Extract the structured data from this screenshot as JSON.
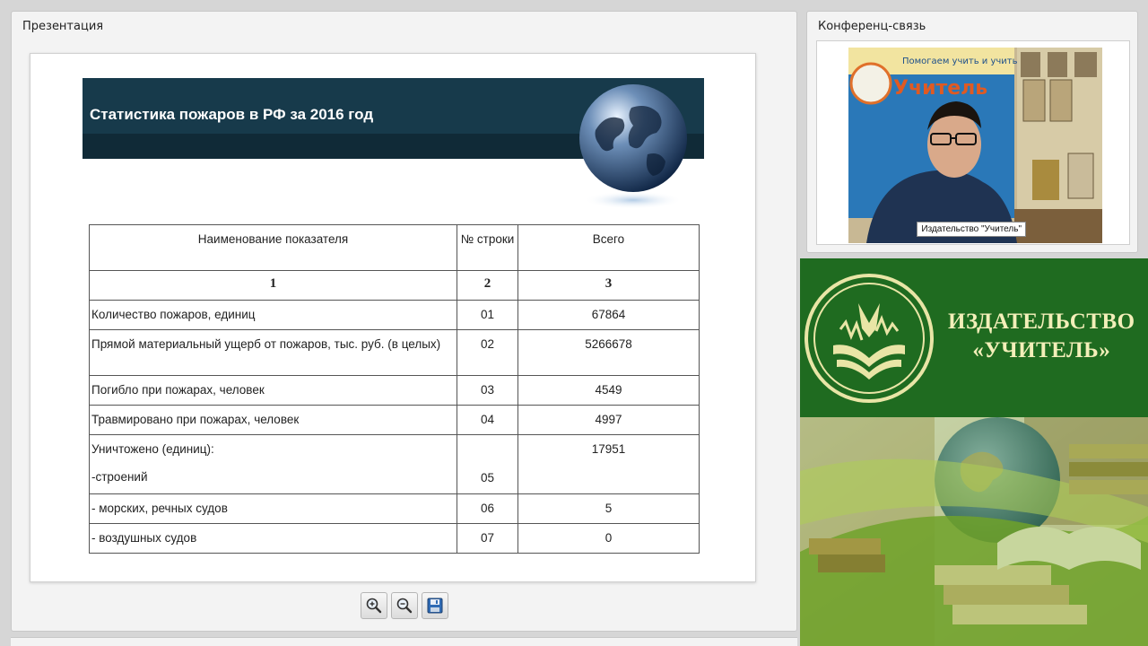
{
  "presentation_panel": {
    "title": "Презентация"
  },
  "slide": {
    "title": "Статистика пожаров в РФ за 2016 год",
    "table": {
      "headers": [
        "Наименование показателя",
        "№ строки",
        "Всего"
      ],
      "column_numbers": [
        "1",
        "2",
        "3"
      ],
      "rows": [
        {
          "name": "Количество пожаров, единиц",
          "line": "01",
          "total": "67864"
        },
        {
          "name": "Прямой материальный ущерб от пожаров, тыс. руб. (в целых)",
          "line": "02",
          "total": "5266678"
        },
        {
          "name": "Погибло при пожарах, человек",
          "line": "03",
          "total": "4549"
        },
        {
          "name": "Травмировано при пожарах, человек",
          "line": "04",
          "total": "4997"
        },
        {
          "name": "Уничтожено (единиц):",
          "name_sub": "-строений",
          "line": "05",
          "total": "17951"
        },
        {
          "name": "- морских, речных судов",
          "line": "06",
          "total": "5"
        },
        {
          "name": "- воздушных судов",
          "line": "07",
          "total": "0"
        }
      ]
    }
  },
  "toolbar": {
    "buttons": [
      "zoom-in-icon",
      "zoom-out-icon",
      "save-icon"
    ]
  },
  "conference_panel": {
    "title": "Конференц-связь",
    "video_label": "Издательство \"Учитель\""
  },
  "banner": {
    "line1": "ИЗДАТЕЛЬСТВО",
    "line2": "«УЧИТЕЛЬ»",
    "poster_text": "Помогаем учить и учиться",
    "poster_brand": "Учитель"
  },
  "colors": {
    "banner_green": "#1f6b20",
    "slide_header": "#173a4b",
    "banner_text": "#f3efb9"
  }
}
